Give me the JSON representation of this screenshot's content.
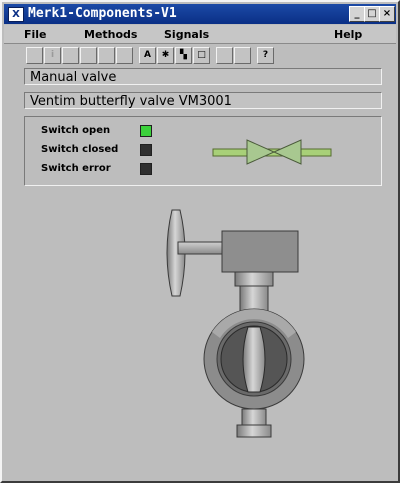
{
  "window": {
    "title": "Merk1-Components-V1",
    "app_icon": "X",
    "controls": {
      "minimize": "_",
      "maximize": "□",
      "close": "×"
    }
  },
  "menubar": {
    "items": [
      "File",
      "Methods",
      "Signals",
      "Help"
    ]
  },
  "toolbar": {
    "buttons": [
      {
        "icon": "help-index-icon",
        "glyph": ""
      },
      {
        "icon": "info-icon",
        "glyph": "i"
      },
      {
        "icon": "history-icon",
        "glyph": ""
      },
      {
        "icon": "trend-icon",
        "glyph": ""
      },
      {
        "icon": "fast-icon",
        "glyph": ""
      },
      {
        "icon": "photo-icon",
        "glyph": ""
      },
      {
        "icon": "graph-icon",
        "glyph": "A"
      },
      {
        "icon": "crossref-icon",
        "glyph": "✱"
      },
      {
        "icon": "object-icon",
        "glyph": "▚"
      },
      {
        "icon": "open-icon",
        "glyph": "□"
      },
      {
        "icon": "doc-icon",
        "glyph": ""
      },
      {
        "icon": "list-icon",
        "glyph": ""
      },
      {
        "icon": "help-icon",
        "glyph": "?"
      }
    ]
  },
  "object_type": "Manual valve",
  "object_description": "Ventim butterfly valve  VM3001",
  "signals": [
    {
      "label": "Switch open",
      "state": "on",
      "color": "#3bd13b"
    },
    {
      "label": "Switch closed",
      "state": "off",
      "color": "#2f2f2f"
    },
    {
      "label": "Switch error",
      "state": "off",
      "color": "#2f2f2f"
    }
  ],
  "colors": {
    "pipe": "#a8d078",
    "valve_symbol": "#a8c890",
    "body_gray": "#8c8c8c"
  }
}
